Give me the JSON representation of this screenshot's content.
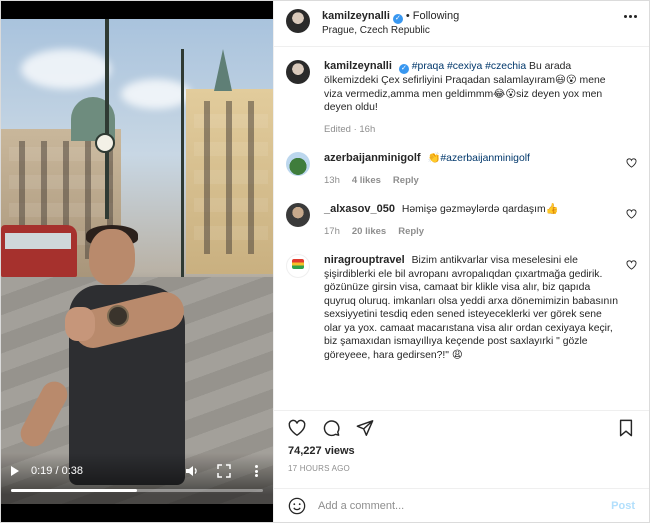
{
  "video": {
    "current_time": "0:19",
    "duration": "0:38",
    "time_display": "0:19 / 0:38",
    "progress_fraction": 0.5
  },
  "header": {
    "username": "kamilzeynalli",
    "follow_label": "Following",
    "location": "Prague, Czech Republic"
  },
  "caption": {
    "username": "kamilzeynalli",
    "hashtags": "#praqa #cexiya #czechia",
    "text": "Bu arada ölkemizdeki Çex sefirliyini Praqadan salamlayıram😃😮 mene viza vermediz,amma men geldimmm😂😮siz deyen yox men deyen oldu!",
    "meta": "Edited · 16h"
  },
  "comments": [
    {
      "username": "azerbaijanminigolf",
      "text": "👏#azerbaijanminigolf",
      "time": "13h",
      "likes": "4 likes",
      "reply": "Reply"
    },
    {
      "username": "_alxasov_050",
      "text": "Həmişə gəzməylərdə qardaşım👍",
      "time": "17h",
      "likes": "20 likes",
      "reply": "Reply"
    },
    {
      "username": "niragrouptravel",
      "text": "Bizim antikvarlar visa meselesini ele şişirdiblerki ele bil avropanı avropalıqdan çıxartmağa gedirik. gözünüze girsin visa, camaat bir klikle visa alır, biz qapıda quyruq oluruq. imkanları olsa yeddi arxa dönemimizin babasının sexsiyyetini tesdiq eden sened isteyeceklerki ver görek sene olar ya yox. camaat macarıstana visa alır ordan cexiyaya keçir, biz şamaxıdan ismayıllıya keçende post saxlayırki \" gözle göreyeee, hara gedirsen?!\" 😩"
    }
  ],
  "stats": {
    "views": "74,227 views",
    "posted_ago": "17 HOURS AGO"
  },
  "add_comment": {
    "placeholder": "Add a comment...",
    "post_label": "Post"
  }
}
